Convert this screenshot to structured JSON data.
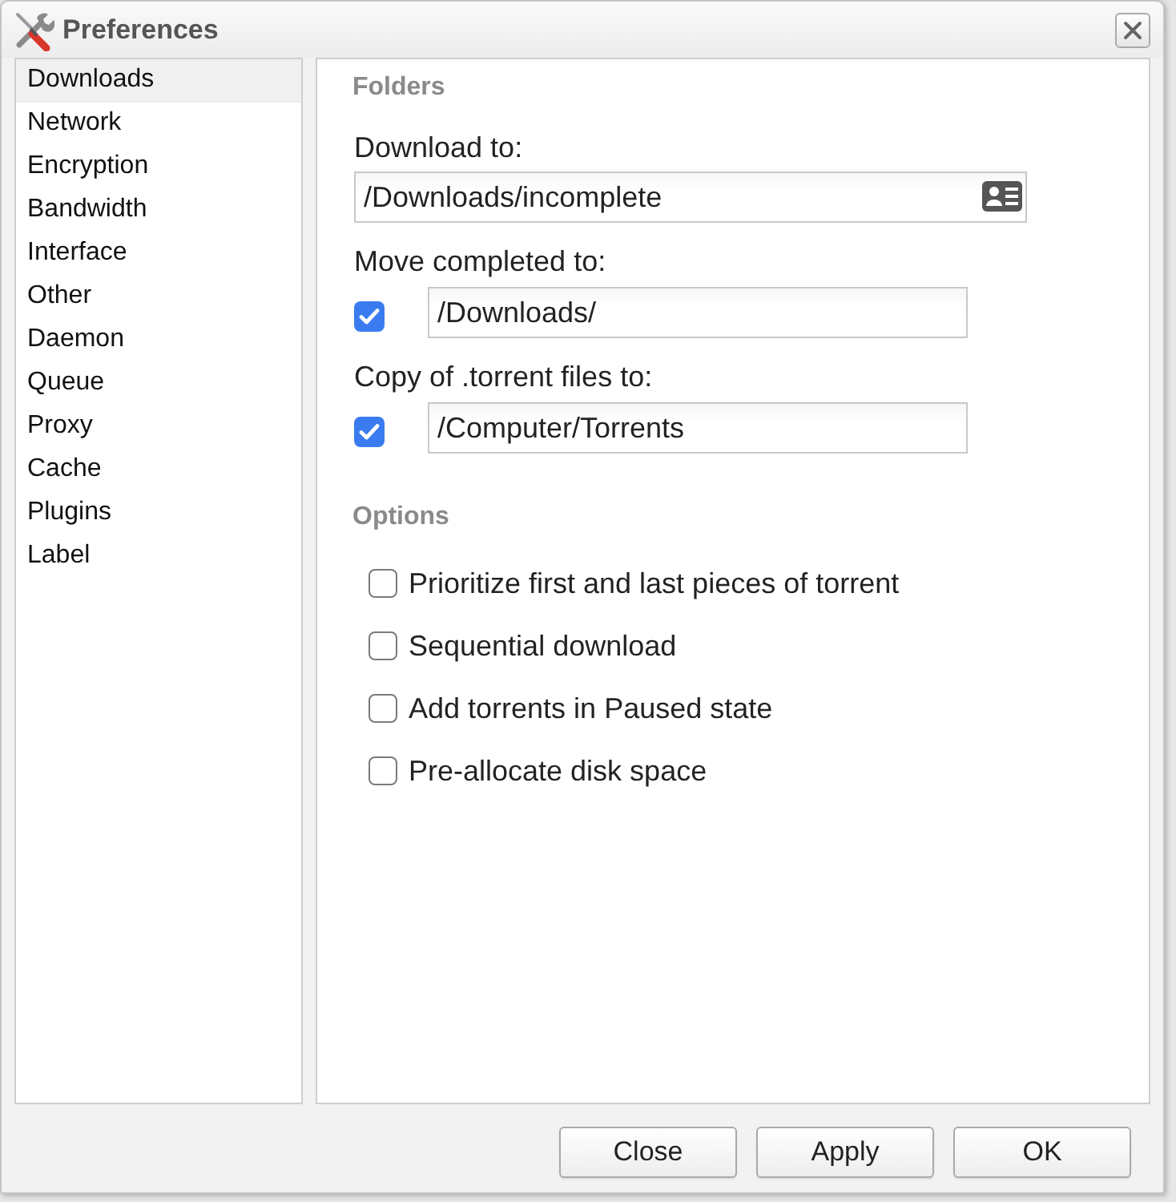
{
  "window": {
    "title": "Preferences"
  },
  "sidebar": {
    "items": [
      {
        "label": "Downloads",
        "selected": true
      },
      {
        "label": "Network",
        "selected": false
      },
      {
        "label": "Encryption",
        "selected": false
      },
      {
        "label": "Bandwidth",
        "selected": false
      },
      {
        "label": "Interface",
        "selected": false
      },
      {
        "label": "Other",
        "selected": false
      },
      {
        "label": "Daemon",
        "selected": false
      },
      {
        "label": "Queue",
        "selected": false
      },
      {
        "label": "Proxy",
        "selected": false
      },
      {
        "label": "Cache",
        "selected": false
      },
      {
        "label": "Plugins",
        "selected": false
      },
      {
        "label": "Label",
        "selected": false
      }
    ]
  },
  "folders": {
    "heading": "Folders",
    "fields": [
      {
        "kind": "browse",
        "label": "Download to:",
        "value": "/Downloads/incomplete"
      },
      {
        "kind": "toggle",
        "label": "Move completed to:",
        "checked": true,
        "value": "/Downloads/"
      },
      {
        "kind": "toggle",
        "label": "Copy of .torrent files to:",
        "checked": true,
        "value": "/Computer/Torrents"
      }
    ]
  },
  "options": {
    "heading": "Options",
    "items": [
      {
        "label": "Prioritize first and last pieces of torrent",
        "checked": false
      },
      {
        "label": "Sequential download",
        "checked": false
      },
      {
        "label": "Add torrents in Paused state",
        "checked": false
      },
      {
        "label": "Pre-allocate disk space",
        "checked": false
      }
    ]
  },
  "buttons": [
    "Close",
    "Apply",
    "OK"
  ]
}
